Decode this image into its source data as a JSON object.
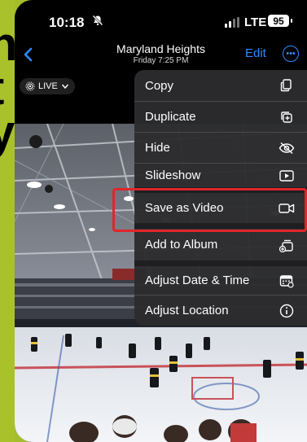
{
  "status_bar": {
    "time": "10:18",
    "carrier": "LTE",
    "battery": "95"
  },
  "nav": {
    "title": "Maryland Heights",
    "subtitle": "Friday  7:25 PM",
    "edit_label": "Edit"
  },
  "live_badge": {
    "label": "LIVE"
  },
  "menu": {
    "items": [
      {
        "label": "Copy",
        "icon": "copy-icon"
      },
      {
        "label": "Duplicate",
        "icon": "duplicate-icon"
      },
      {
        "label": "Hide",
        "icon": "eye-slash-icon"
      },
      {
        "label": "Slideshow",
        "icon": "play-rectangle-icon"
      },
      {
        "label": "Save as Video",
        "icon": "video-camera-icon"
      },
      {
        "label": "Add to Album",
        "icon": "add-to-album-icon"
      },
      {
        "label": "Adjust Date & Time",
        "icon": "calendar-icon"
      },
      {
        "label": "Adjust Location",
        "icon": "info-icon"
      }
    ]
  },
  "colors": {
    "accent": "#2f8bff",
    "highlight": "#e0262a",
    "menu_bg": "#2c2c2e",
    "strip": "#a9c12a"
  }
}
